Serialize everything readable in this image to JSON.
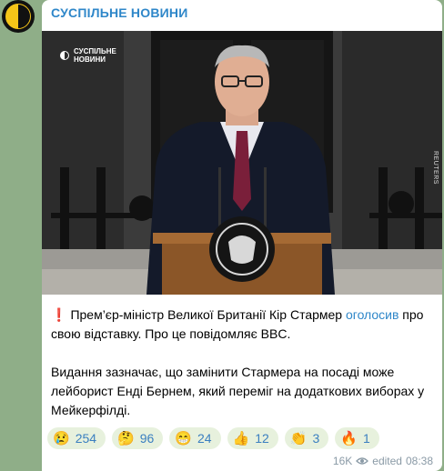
{
  "channel": {
    "name": "СУСПІЛЬНЕ НОВИНИ",
    "avatar_icon": "suspilne-logo-icon"
  },
  "photo": {
    "watermark": "СУСПІЛЬНЕ\nНОВИНИ",
    "credit": "REUTERS"
  },
  "message": {
    "paragraph1": {
      "icon": "exclamation-icon",
      "icon_glyph": "❗",
      "before": "Прем’єр-міністр Великої Британії Кір Стармер ",
      "link": "оголосив",
      "after": " про свою відставку. Про це повідомляє BBC."
    },
    "paragraph2": "Видання зазначає, що замінити Стармера на посаді може лейборист Енді Бернем, який переміг на додаткових виборах у Мейкерфілді."
  },
  "reactions": [
    {
      "emoji": "😢",
      "count": "254",
      "icon": "crying-face-icon"
    },
    {
      "emoji": "🤔",
      "count": "96",
      "icon": "thinking-face-icon"
    },
    {
      "emoji": "😁",
      "count": "24",
      "icon": "grinning-face-icon"
    },
    {
      "emoji": "👍",
      "count": "12",
      "icon": "thumbs-up-icon"
    },
    {
      "emoji": "👏",
      "count": "3",
      "icon": "clapping-hands-icon"
    },
    {
      "emoji": "🔥",
      "count": "1",
      "icon": "fire-icon"
    }
  ],
  "meta": {
    "views": "16K",
    "edited": "edited",
    "time": "08:38"
  },
  "colors": {
    "background": "#8fae88",
    "accent": "#2f87c9",
    "reaction_bg": "#e7f1dd"
  }
}
